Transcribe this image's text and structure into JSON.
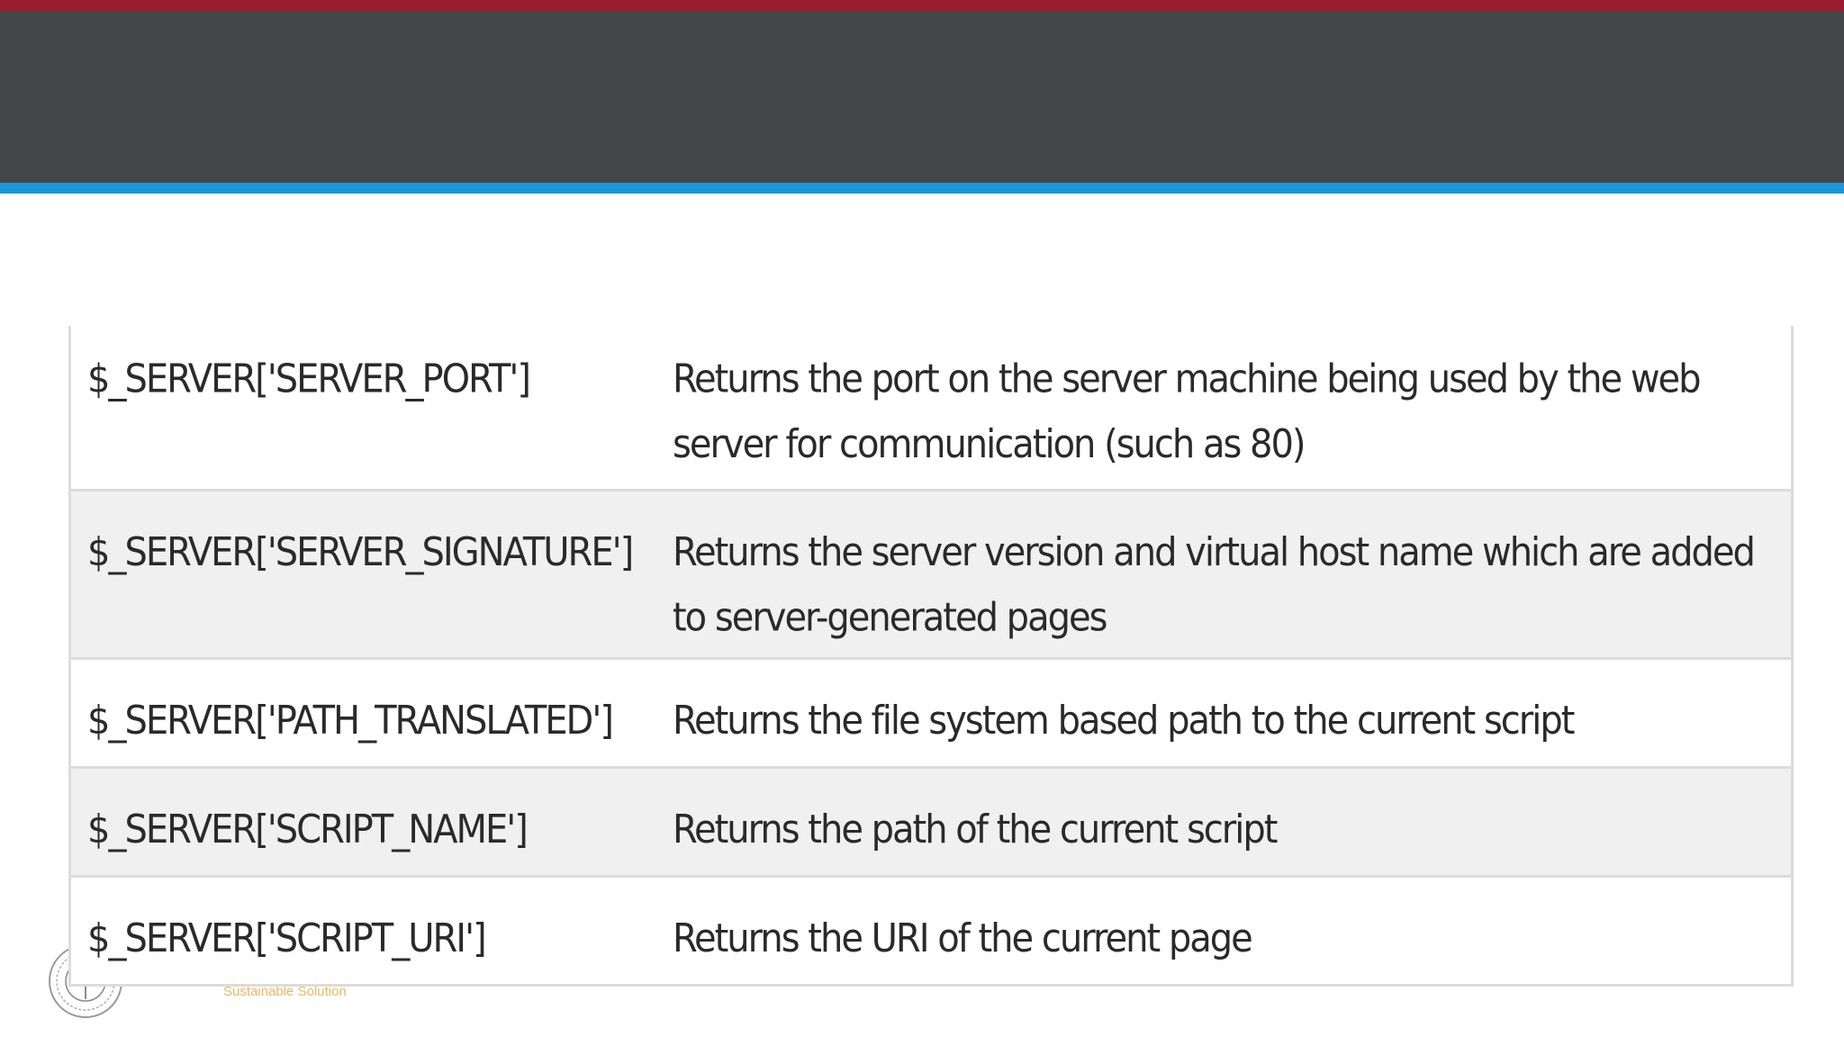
{
  "colors": {
    "top_strip": "#9b1b30",
    "header_band": "#434749",
    "accent_strip": "#1b96dd",
    "row_alt": "#f0f0f0",
    "border": "#dcdcdc",
    "logo_tagline": "#e8a33a"
  },
  "logo": {
    "icon": "circular-seal-icon",
    "tagline": "Sustainable Solution"
  },
  "table": {
    "rows": [
      {
        "key": "$_SERVER['SERVER_PORT']",
        "description": "Returns the port on the server machine being used by the web server for communication (such as 80)"
      },
      {
        "key": "$_SERVER['SERVER_SIGNATURE']",
        "description": "Returns the server version and virtual host name which are added to server-generated pages"
      },
      {
        "key": "$_SERVER['PATH_TRANSLATED']",
        "description": "Returns the file system based path to the current script"
      },
      {
        "key": "$_SERVER['SCRIPT_NAME']",
        "description": "Returns the path of the current script"
      },
      {
        "key": "$_SERVER['SCRIPT_URI']",
        "description": "Returns the URI of the current page"
      }
    ]
  }
}
